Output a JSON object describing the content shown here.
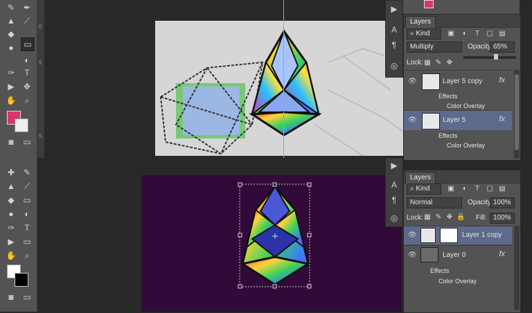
{
  "tools": {
    "glyphs": [
      "✎",
      "✒",
      "▲",
      "⟋",
      "⟋",
      "⟋",
      "◐",
      "▭",
      "◆",
      "●",
      "✑",
      "T",
      "▶",
      "✥",
      "✋",
      "⌕"
    ],
    "type_label": "T"
  },
  "colors": {
    "foreground_top": "#d9346b",
    "background_top": "#eeeeee",
    "foreground_bottom": "#ffffff",
    "background_bottom": "#000000",
    "canvas_top_bg": "#d6d6d6",
    "canvas_bottom_bg": "#320a3a",
    "selected_layer": "#5d6a8b"
  },
  "ruler_top": {
    "marks": [
      "0",
      "5",
      "5"
    ]
  },
  "panel_top": {
    "tab_label": "Layers",
    "filter_label": "Kind",
    "blend_mode": "Multiply",
    "opacity_label": "Opacity:",
    "opacity_value": "65%",
    "lock_label": "Lock:",
    "layers": [
      {
        "name": "Layer 5 copy",
        "fx": "fx",
        "effects_label": "Effects",
        "effect": "Color Overlay",
        "selected": false
      },
      {
        "name": "Layer 5",
        "fx": "fx",
        "effects_label": "Effects",
        "effect": "Color Overlay",
        "selected": true
      }
    ]
  },
  "panel_bottom": {
    "tab_label": "Layers",
    "filter_label": "Kind",
    "blend_mode": "Normal",
    "opacity_label": "Opacity:",
    "opacity_value": "100%",
    "lock_label": "Lock:",
    "fill_label": "Fill:",
    "fill_value": "100%",
    "layers": [
      {
        "name": "Layer 1 copy",
        "fx": "",
        "selected": true
      },
      {
        "name": "Layer 0",
        "fx": "fx",
        "effects_label": "Effects",
        "effect": "Color Overlay",
        "selected": false
      }
    ]
  }
}
